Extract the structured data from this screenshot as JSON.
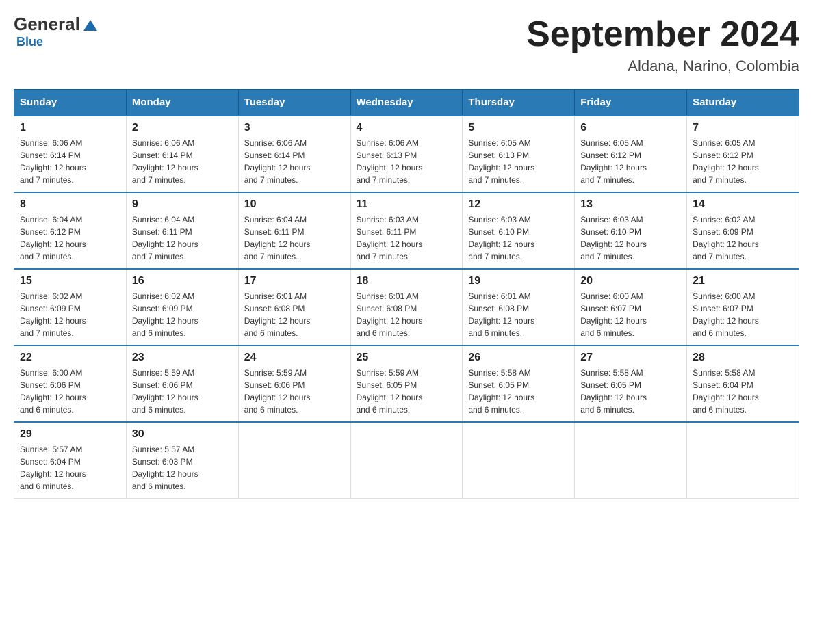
{
  "header": {
    "logo": {
      "general": "General",
      "blue": "Blue",
      "triangle": "▲"
    },
    "title": "September 2024",
    "subtitle": "Aldana, Narino, Colombia"
  },
  "days_of_week": [
    "Sunday",
    "Monday",
    "Tuesday",
    "Wednesday",
    "Thursday",
    "Friday",
    "Saturday"
  ],
  "weeks": [
    [
      {
        "day": "1",
        "sunrise": "6:06 AM",
        "sunset": "6:14 PM",
        "daylight": "12 hours and 7 minutes."
      },
      {
        "day": "2",
        "sunrise": "6:06 AM",
        "sunset": "6:14 PM",
        "daylight": "12 hours and 7 minutes."
      },
      {
        "day": "3",
        "sunrise": "6:06 AM",
        "sunset": "6:14 PM",
        "daylight": "12 hours and 7 minutes."
      },
      {
        "day": "4",
        "sunrise": "6:06 AM",
        "sunset": "6:13 PM",
        "daylight": "12 hours and 7 minutes."
      },
      {
        "day": "5",
        "sunrise": "6:05 AM",
        "sunset": "6:13 PM",
        "daylight": "12 hours and 7 minutes."
      },
      {
        "day": "6",
        "sunrise": "6:05 AM",
        "sunset": "6:12 PM",
        "daylight": "12 hours and 7 minutes."
      },
      {
        "day": "7",
        "sunrise": "6:05 AM",
        "sunset": "6:12 PM",
        "daylight": "12 hours and 7 minutes."
      }
    ],
    [
      {
        "day": "8",
        "sunrise": "6:04 AM",
        "sunset": "6:12 PM",
        "daylight": "12 hours and 7 minutes."
      },
      {
        "day": "9",
        "sunrise": "6:04 AM",
        "sunset": "6:11 PM",
        "daylight": "12 hours and 7 minutes."
      },
      {
        "day": "10",
        "sunrise": "6:04 AM",
        "sunset": "6:11 PM",
        "daylight": "12 hours and 7 minutes."
      },
      {
        "day": "11",
        "sunrise": "6:03 AM",
        "sunset": "6:11 PM",
        "daylight": "12 hours and 7 minutes."
      },
      {
        "day": "12",
        "sunrise": "6:03 AM",
        "sunset": "6:10 PM",
        "daylight": "12 hours and 7 minutes."
      },
      {
        "day": "13",
        "sunrise": "6:03 AM",
        "sunset": "6:10 PM",
        "daylight": "12 hours and 7 minutes."
      },
      {
        "day": "14",
        "sunrise": "6:02 AM",
        "sunset": "6:09 PM",
        "daylight": "12 hours and 7 minutes."
      }
    ],
    [
      {
        "day": "15",
        "sunrise": "6:02 AM",
        "sunset": "6:09 PM",
        "daylight": "12 hours and 7 minutes."
      },
      {
        "day": "16",
        "sunrise": "6:02 AM",
        "sunset": "6:09 PM",
        "daylight": "12 hours and 6 minutes."
      },
      {
        "day": "17",
        "sunrise": "6:01 AM",
        "sunset": "6:08 PM",
        "daylight": "12 hours and 6 minutes."
      },
      {
        "day": "18",
        "sunrise": "6:01 AM",
        "sunset": "6:08 PM",
        "daylight": "12 hours and 6 minutes."
      },
      {
        "day": "19",
        "sunrise": "6:01 AM",
        "sunset": "6:08 PM",
        "daylight": "12 hours and 6 minutes."
      },
      {
        "day": "20",
        "sunrise": "6:00 AM",
        "sunset": "6:07 PM",
        "daylight": "12 hours and 6 minutes."
      },
      {
        "day": "21",
        "sunrise": "6:00 AM",
        "sunset": "6:07 PM",
        "daylight": "12 hours and 6 minutes."
      }
    ],
    [
      {
        "day": "22",
        "sunrise": "6:00 AM",
        "sunset": "6:06 PM",
        "daylight": "12 hours and 6 minutes."
      },
      {
        "day": "23",
        "sunrise": "5:59 AM",
        "sunset": "6:06 PM",
        "daylight": "12 hours and 6 minutes."
      },
      {
        "day": "24",
        "sunrise": "5:59 AM",
        "sunset": "6:06 PM",
        "daylight": "12 hours and 6 minutes."
      },
      {
        "day": "25",
        "sunrise": "5:59 AM",
        "sunset": "6:05 PM",
        "daylight": "12 hours and 6 minutes."
      },
      {
        "day": "26",
        "sunrise": "5:58 AM",
        "sunset": "6:05 PM",
        "daylight": "12 hours and 6 minutes."
      },
      {
        "day": "27",
        "sunrise": "5:58 AM",
        "sunset": "6:05 PM",
        "daylight": "12 hours and 6 minutes."
      },
      {
        "day": "28",
        "sunrise": "5:58 AM",
        "sunset": "6:04 PM",
        "daylight": "12 hours and 6 minutes."
      }
    ],
    [
      {
        "day": "29",
        "sunrise": "5:57 AM",
        "sunset": "6:04 PM",
        "daylight": "12 hours and 6 minutes."
      },
      {
        "day": "30",
        "sunrise": "5:57 AM",
        "sunset": "6:03 PM",
        "daylight": "12 hours and 6 minutes."
      },
      null,
      null,
      null,
      null,
      null
    ]
  ],
  "labels": {
    "sunrise_prefix": "Sunrise: ",
    "sunset_prefix": "Sunset: ",
    "daylight_prefix": "Daylight: "
  }
}
